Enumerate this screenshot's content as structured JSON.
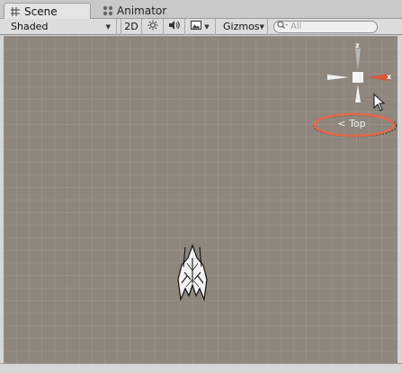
{
  "tabs": [
    {
      "label": "Scene",
      "icon": "grid-icon",
      "active": true
    },
    {
      "label": "Animator",
      "icon": "animator-icon",
      "active": false
    }
  ],
  "toolbar": {
    "shading_mode": "Shaded",
    "mode_2d_label": "2D",
    "gizmos_label": "Gizmos",
    "search_placeholder": "All"
  },
  "scene": {
    "view_label": "Top",
    "gizmo_axes": {
      "z": "z",
      "x": "x"
    },
    "highlight_color": "#e06a4a",
    "background_color": "#8e857c",
    "x_axis_color": "#d9573a"
  }
}
